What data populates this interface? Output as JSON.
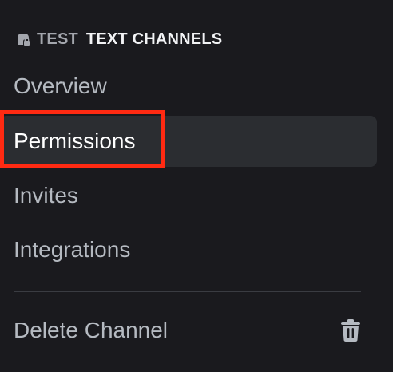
{
  "header": {
    "category_name": "TEST",
    "section_name": "TEXT CHANNELS",
    "category_icon": "locked-folder-icon"
  },
  "menu": {
    "items": [
      {
        "label": "Overview"
      },
      {
        "label": "Permissions",
        "selected": true
      },
      {
        "label": "Invites"
      },
      {
        "label": "Integrations"
      }
    ],
    "delete_label": "Delete Channel",
    "delete_icon": "trash-icon"
  },
  "colors": {
    "background": "#1a1a1e",
    "selected_background": "#2b2d31",
    "highlight_border": "#ff2a12",
    "text_muted": "#b5bac1",
    "text_active": "#ffffff"
  }
}
